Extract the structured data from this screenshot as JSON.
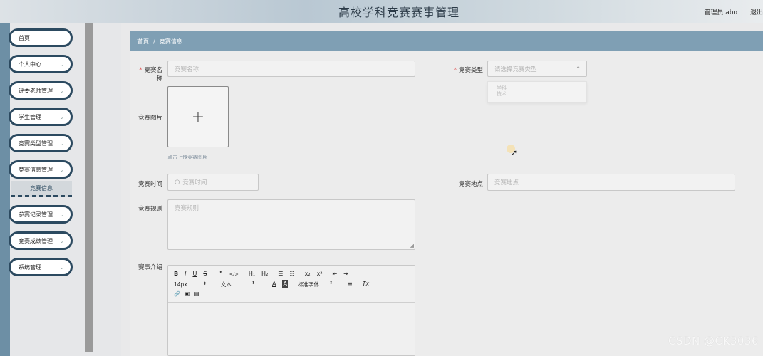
{
  "header": {
    "title": "高校学科竞赛赛事管理",
    "user_label": "管理员 abo",
    "logout_label": "退出"
  },
  "sidebar": {
    "items": [
      {
        "label": "首页",
        "has_chevron": false
      },
      {
        "label": "个人中心",
        "has_chevron": true
      },
      {
        "label": "评委老师管理",
        "has_chevron": true
      },
      {
        "label": "学生管理",
        "has_chevron": true
      },
      {
        "label": "竞赛类型管理",
        "has_chevron": true
      },
      {
        "label": "竞赛信息管理",
        "has_chevron": true
      },
      {
        "label": "参赛记录管理",
        "has_chevron": true
      },
      {
        "label": "竞赛成绩管理",
        "has_chevron": true
      },
      {
        "label": "系统管理",
        "has_chevron": true
      }
    ],
    "active_sub": "竞赛信息"
  },
  "breadcrumb": {
    "home": "首页",
    "separator": "/",
    "current": "竞赛信息"
  },
  "form": {
    "name": {
      "label": "竞赛名称",
      "placeholder": "竞赛名称"
    },
    "type": {
      "label": "竞赛类型",
      "placeholder": "请选择竞赛类型",
      "options": [
        "学科",
        "技术"
      ]
    },
    "image": {
      "label": "竞赛图片",
      "upload_glyph": "+",
      "hint": "点击上传竞赛图片"
    },
    "time": {
      "label": "竞赛时间",
      "placeholder": "竞赛时间"
    },
    "location": {
      "label": "竞赛地点",
      "placeholder": "竞赛地点"
    },
    "rules": {
      "label": "竞赛规则",
      "placeholder": "竞赛规则"
    },
    "intro": {
      "label": "赛事介绍"
    }
  },
  "editor": {
    "row1": [
      "B",
      "I",
      "U",
      "S",
      "❞",
      "</>",
      "H₁",
      "H₂",
      "☰",
      "☷",
      "x₂",
      "x²",
      "⇤",
      "⇥"
    ],
    "font_size": "14px",
    "text_style": "文本",
    "font_family": "标准字体",
    "row2_icons": [
      "A",
      "A",
      "≡",
      "Tx"
    ],
    "row3_icons": [
      "🔗",
      "▣",
      "▤"
    ]
  },
  "watermark": "CSDN @CK3036"
}
